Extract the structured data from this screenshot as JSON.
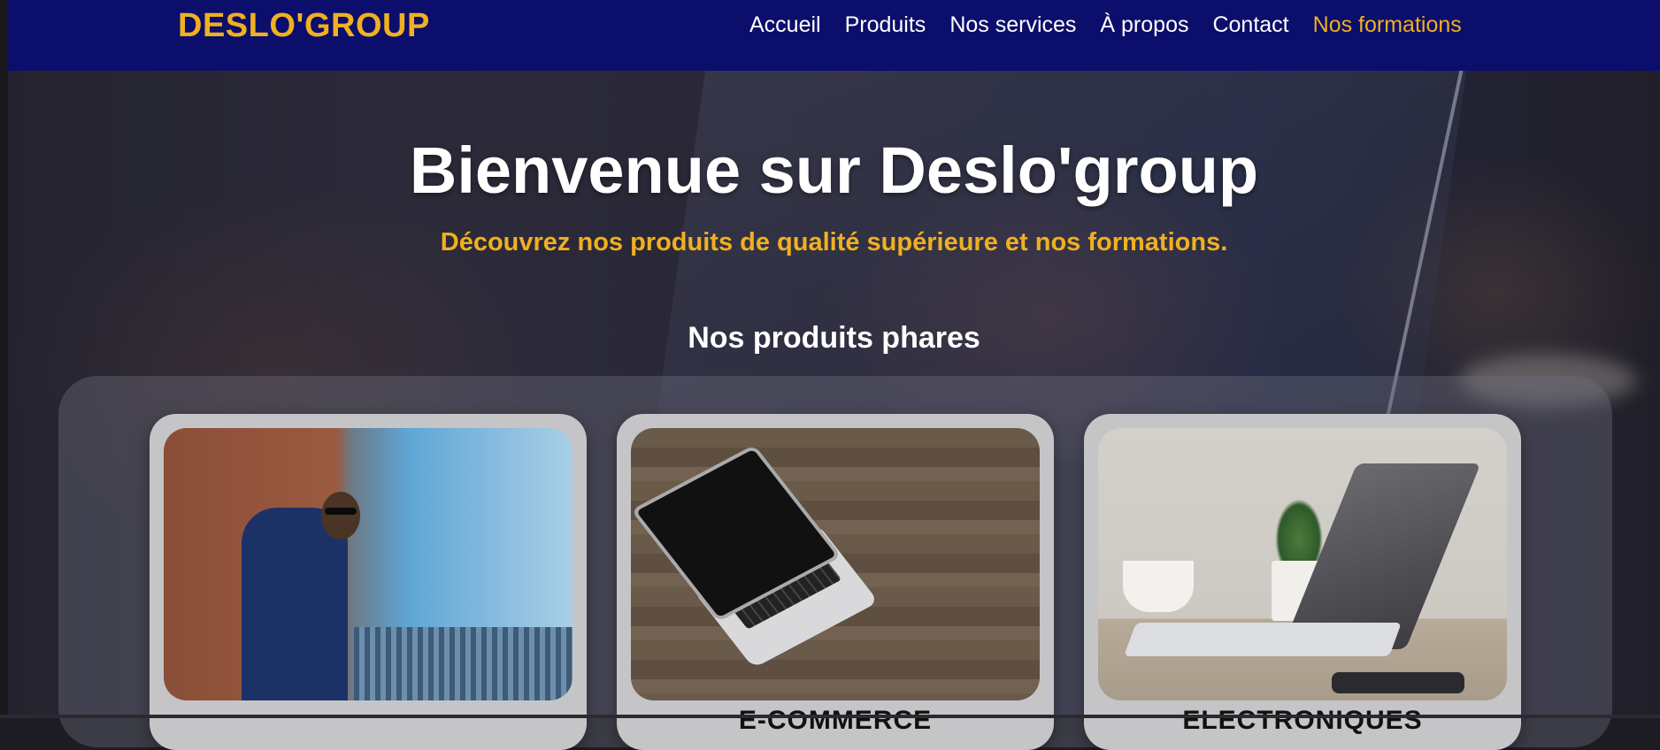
{
  "brand": {
    "logo": "DESLO'GROUP",
    "accent_color": "#f0b020",
    "nav_bg": "#0b0e6b"
  },
  "nav": {
    "items": [
      {
        "label": "Accueil",
        "active": false
      },
      {
        "label": "Produits",
        "active": false
      },
      {
        "label": "Nos services",
        "active": false
      },
      {
        "label": "À propos",
        "active": false
      },
      {
        "label": "Contact",
        "active": false
      },
      {
        "label": "Nos formations",
        "active": true
      }
    ]
  },
  "hero": {
    "title": "Bienvenue sur Deslo'group",
    "subtitle": "Découvrez nos produits de qualité supérieure et nos formations."
  },
  "products": {
    "section_title": "Nos produits phares",
    "cards": [
      {
        "image": "man-in-suit-photo",
        "caption": ""
      },
      {
        "image": "laptop-on-wood-photo",
        "caption": "E-COMMERCE"
      },
      {
        "image": "desk-laptop-plant-photo",
        "caption": "ELECTRONIQUES"
      }
    ]
  }
}
